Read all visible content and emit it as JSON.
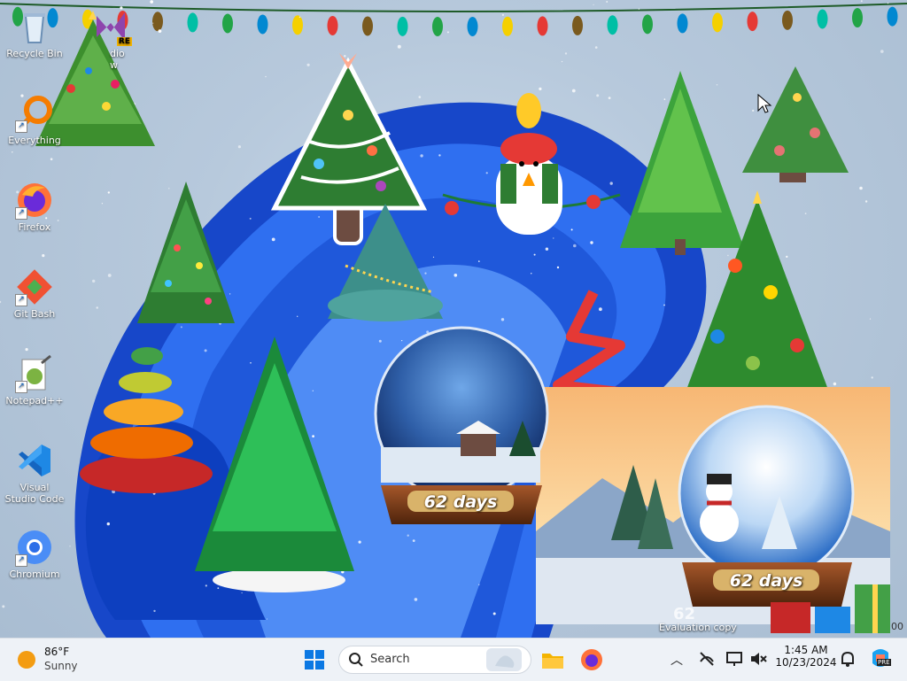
{
  "desktop_icons": [
    {
      "label": "Recycle Bin",
      "icon": "recycle-bin-icon"
    },
    {
      "label": "Everything",
      "icon": "everything-search-icon"
    },
    {
      "label": "Firefox",
      "icon": "firefox-icon"
    },
    {
      "label": "Git Bash",
      "icon": "git-bash-icon"
    },
    {
      "label": "Notepad++",
      "icon": "notepadpp-icon"
    },
    {
      "label": "Visual Studio Code",
      "icon": "vscode-icon"
    },
    {
      "label": "Chromium",
      "icon": "chromium-icon"
    }
  ],
  "partial_icon_label": "dio\nw",
  "partial_icon_badge": "RE",
  "widgets": {
    "globe1_counter": "62 days",
    "globe2_counter": "62 days",
    "watermark_counter": "62",
    "evaluation_text": "Evaluation copy",
    "edge_text": "00"
  },
  "taskbar": {
    "weather": {
      "temp": "86°F",
      "condition": "Sunny"
    },
    "search": {
      "label": "Search"
    },
    "clock": {
      "time": "1:45 AM",
      "date": "10/23/2024"
    },
    "copilot_badge": "PRE"
  },
  "colors": {
    "taskbar_bg": "#eef2f7",
    "accent_blue": "#0b5cd6"
  }
}
